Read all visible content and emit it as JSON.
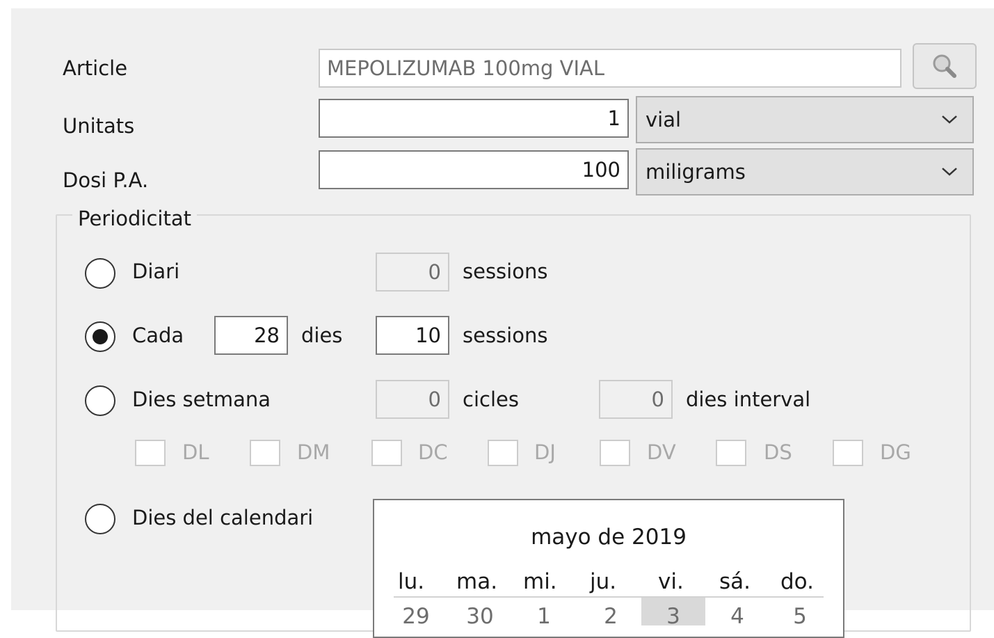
{
  "form": {
    "article_label": "Article",
    "article_value": "MEPOLIZUMAB 100mg VIAL",
    "units_label": "Unitats",
    "units_value": "1",
    "units_unit": "vial",
    "dose_label": "Dosi P.A.",
    "dose_value": "100",
    "dose_unit": "miligrams"
  },
  "periodicity": {
    "title": "Periodicitat",
    "selected": "cada",
    "daily": {
      "label": "Diari",
      "sessions_value": "0",
      "sessions_label": "sessions"
    },
    "every": {
      "label": "Cada",
      "days_value": "28",
      "days_label": "dies",
      "sessions_value": "10",
      "sessions_label": "sessions"
    },
    "weekdays": {
      "label": "Dies setmana",
      "cycles_value": "0",
      "cycles_label": "cicles",
      "interval_value": "0",
      "interval_label": "dies interval",
      "days": [
        "DL",
        "DM",
        "DC",
        "DJ",
        "DV",
        "DS",
        "DG"
      ]
    },
    "calendar_days": {
      "label": "Dies del calendari"
    }
  },
  "calendar": {
    "month_title": "mayo de 2019",
    "weekdays": [
      "lu.",
      "ma.",
      "mi.",
      "ju.",
      "vi.",
      "sá.",
      "do."
    ],
    "first_row": [
      "29",
      "30",
      "1",
      "2",
      "3",
      "4",
      "5"
    ],
    "today": "3"
  },
  "colors": {
    "panel_bg": "#f0f0f0",
    "border": "#7a7a7a",
    "disabled_text": "#a8a8a8"
  }
}
